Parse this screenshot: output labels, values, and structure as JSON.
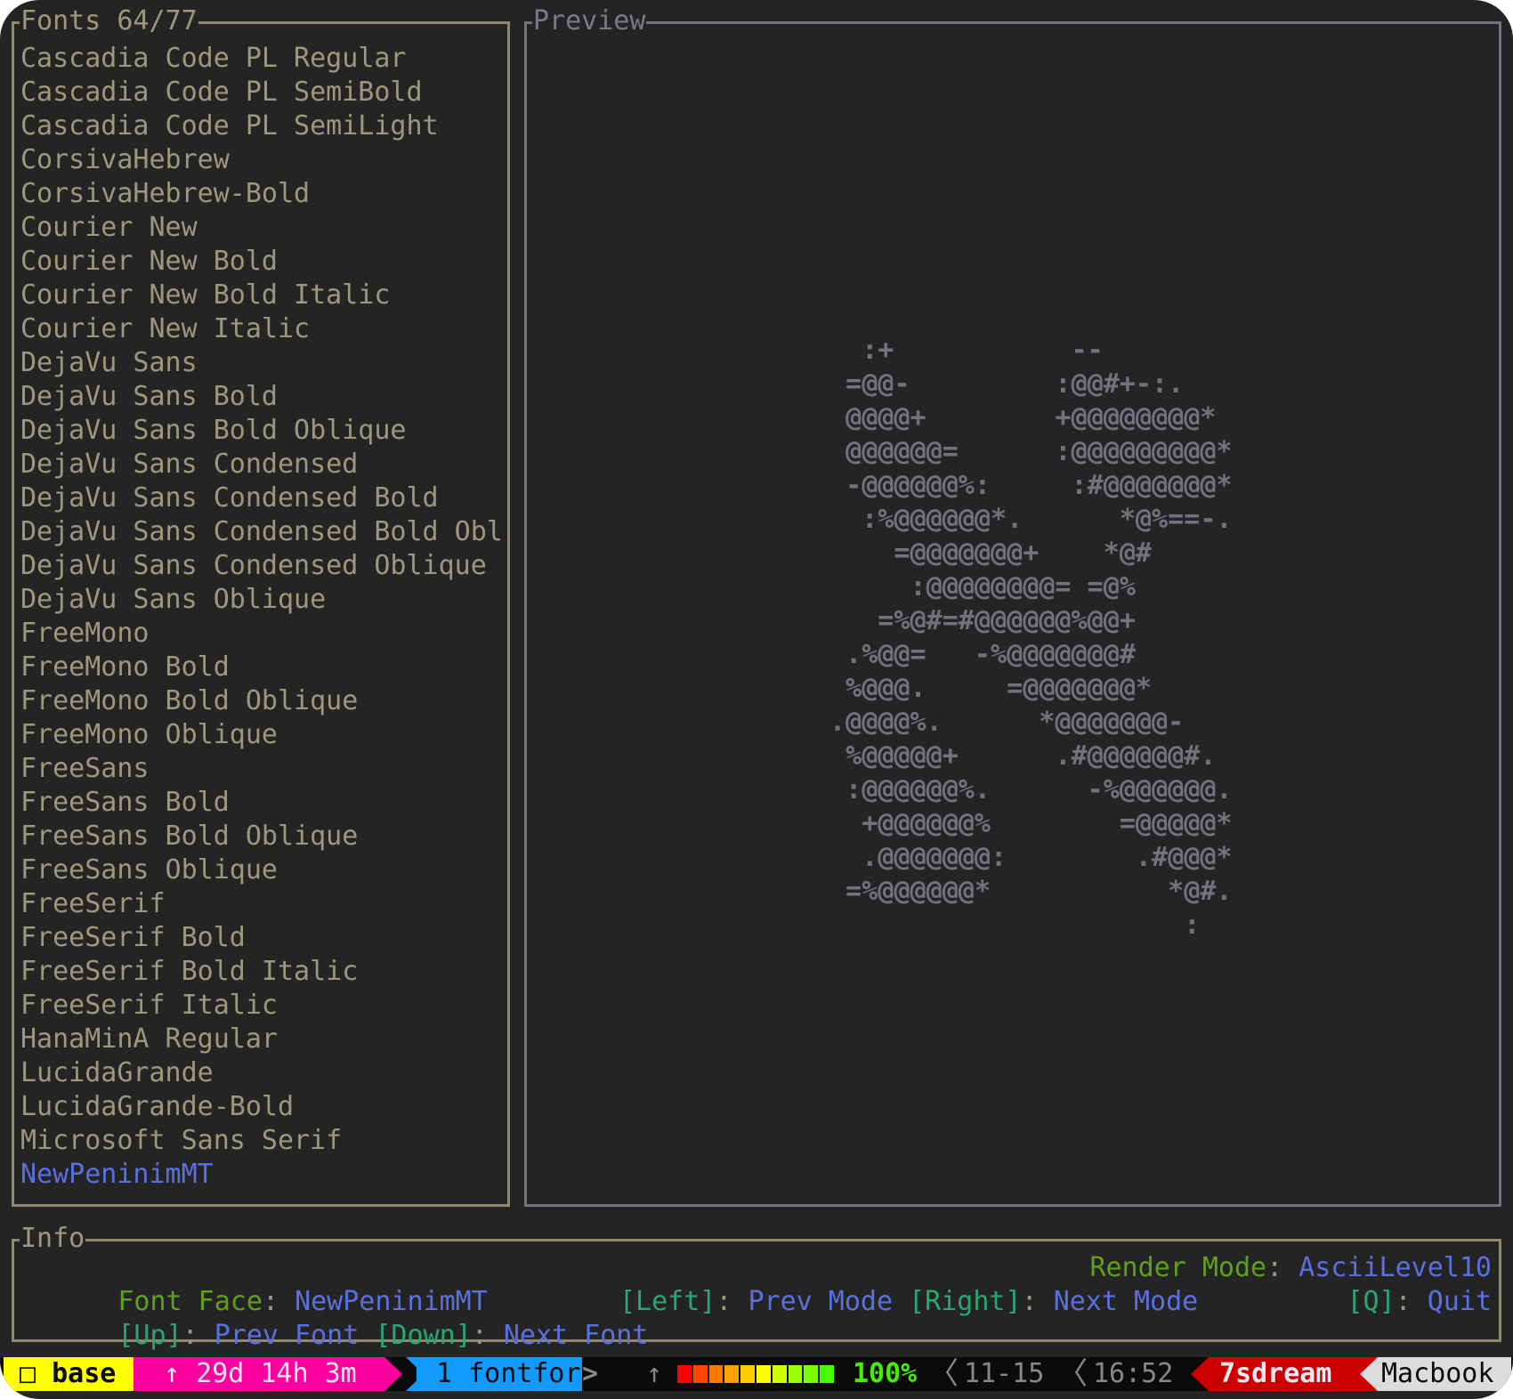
{
  "fonts_panel": {
    "title": "Fonts 64/77",
    "items": [
      {
        "label": "Cascadia Code PL Regular",
        "selected": false
      },
      {
        "label": "Cascadia Code PL SemiBold",
        "selected": false
      },
      {
        "label": "Cascadia Code PL SemiLight",
        "selected": false
      },
      {
        "label": "CorsivaHebrew",
        "selected": false
      },
      {
        "label": "CorsivaHebrew-Bold",
        "selected": false
      },
      {
        "label": "Courier New",
        "selected": false
      },
      {
        "label": "Courier New Bold",
        "selected": false
      },
      {
        "label": "Courier New Bold Italic",
        "selected": false
      },
      {
        "label": "Courier New Italic",
        "selected": false
      },
      {
        "label": "DejaVu Sans",
        "selected": false
      },
      {
        "label": "DejaVu Sans Bold",
        "selected": false
      },
      {
        "label": "DejaVu Sans Bold Oblique",
        "selected": false
      },
      {
        "label": "DejaVu Sans Condensed",
        "selected": false
      },
      {
        "label": "DejaVu Sans Condensed Bold",
        "selected": false
      },
      {
        "label": "DejaVu Sans Condensed Bold Obl",
        "selected": false
      },
      {
        "label": "DejaVu Sans Condensed Oblique",
        "selected": false
      },
      {
        "label": "DejaVu Sans Oblique",
        "selected": false
      },
      {
        "label": "FreeMono",
        "selected": false
      },
      {
        "label": "FreeMono Bold",
        "selected": false
      },
      {
        "label": "FreeMono Bold Oblique",
        "selected": false
      },
      {
        "label": "FreeMono Oblique",
        "selected": false
      },
      {
        "label": "FreeSans",
        "selected": false
      },
      {
        "label": "FreeSans Bold",
        "selected": false
      },
      {
        "label": "FreeSans Bold Oblique",
        "selected": false
      },
      {
        "label": "FreeSans Oblique",
        "selected": false
      },
      {
        "label": "FreeSerif",
        "selected": false
      },
      {
        "label": "FreeSerif Bold",
        "selected": false
      },
      {
        "label": "FreeSerif Bold Italic",
        "selected": false
      },
      {
        "label": "FreeSerif Italic",
        "selected": false
      },
      {
        "label": "HanaMinA Regular",
        "selected": false
      },
      {
        "label": "LucidaGrande",
        "selected": false
      },
      {
        "label": "LucidaGrande-Bold",
        "selected": false
      },
      {
        "label": "Microsoft Sans Serif",
        "selected": false
      },
      {
        "label": "NewPeninimMT",
        "selected": true
      }
    ]
  },
  "preview_panel": {
    "title": "Preview",
    "ascii_lines": [
      "  :+           --",
      " =@@-         :@@#+-:.",
      " @@@@+        +@@@@@@@@*",
      " @@@@@@=      :@@@@@@@@@*",
      " -@@@@@@%:     :#@@@@@@@*",
      "  :%@@@@@@*.      *@%==-.",
      "    =@@@@@@@+    *@#",
      "     :@@@@@@@@= =@%",
      "   =%@#=#@@@@@@%@@+",
      " .%@@=   -%@@@@@@@#",
      " %@@@.     =@@@@@@@*",
      ".@@@@%.      *@@@@@@@-",
      " %@@@@@+      .#@@@@@@#.",
      " :@@@@@@%.      -%@@@@@@.",
      "  +@@@@@@%        =@@@@@*",
      "  .@@@@@@@:        .#@@@*",
      " =%@@@@@@*           *@#.",
      "                      :"
    ]
  },
  "info_panel": {
    "title": "Info",
    "font_face_label": "Font Face",
    "font_face_value": "NewPeninimMT",
    "render_mode_label": "Render Mode",
    "render_mode_value": "AsciiLevel10",
    "separator": ":",
    "keys": {
      "up_key": "[Up]",
      "up_action": "Prev Font",
      "down_key": "[Down]",
      "down_action": "Next Font",
      "left_key": "[Left]",
      "left_action": "Prev Mode",
      "right_key": "[Right]",
      "right_action": "Next Mode",
      "quit_key": "[Q]",
      "quit_action": "Quit"
    }
  },
  "status_bar": {
    "session": {
      "icon": "square-icon",
      "glyph": "□",
      "label": "base",
      "color": "#ffff00"
    },
    "uptime": {
      "icon": "arrow-up-icon",
      "glyph": "↑",
      "label": "29d 14h 3m",
      "color": "#ff00a0"
    },
    "window": {
      "label": "1 fontfor",
      "more": ">",
      "color": "#139aff"
    },
    "battery": {
      "icon": "arrow-up-icon",
      "glyph": "↑",
      "percent": 100,
      "label": "100%",
      "cell_colors": [
        "#ff0000",
        "#ff4400",
        "#ff7700",
        "#ffa000",
        "#ffcc00",
        "#ffff00",
        "#ccff00",
        "#99ff00",
        "#77ff00",
        "#44ff00"
      ]
    },
    "date": "11-15",
    "time": "16:52",
    "separator_glyph": "〈",
    "host": {
      "label": "7sdream",
      "color": "#cc0000"
    },
    "machine": {
      "label": "Macbook",
      "color": "#dcdcdc"
    }
  }
}
